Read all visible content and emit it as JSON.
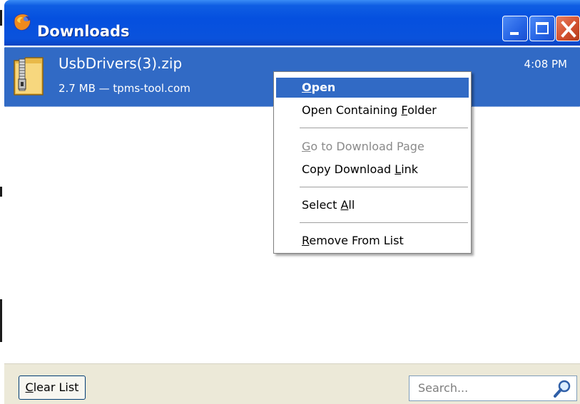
{
  "window": {
    "title": "Downloads",
    "app_icon": "firefox-icon",
    "controls": [
      "minimize-icon",
      "maximize-icon",
      "close-icon"
    ]
  },
  "download": {
    "file_name": "UsbDrivers(3).zip",
    "meta": "2.7 MB — tpms-tool.com",
    "time": "4:08 PM",
    "icon": "zip-file-icon"
  },
  "context_menu": {
    "items": [
      {
        "pre": "",
        "key": "O",
        "post": "pen",
        "state": "active"
      },
      {
        "pre": "Open Containing ",
        "key": "F",
        "post": "older",
        "state": "normal"
      },
      {
        "pre": "",
        "key": "G",
        "post": "o to Download Page",
        "state": "disabled"
      },
      {
        "pre": "Copy Download ",
        "key": "L",
        "post": "ink",
        "state": "normal"
      },
      {
        "pre": "Select ",
        "key": "A",
        "post": "ll",
        "state": "normal"
      },
      {
        "pre": "",
        "key": "R",
        "post": "emove From List",
        "state": "normal"
      }
    ]
  },
  "bottom": {
    "clear_key": "C",
    "clear_rest": "lear List",
    "search_placeholder": "Search..."
  },
  "colors": {
    "titlebar": "#0550df",
    "selection": "#316ac5",
    "close_button": "#d3512f",
    "toolbar_bg": "#ece9d8"
  }
}
